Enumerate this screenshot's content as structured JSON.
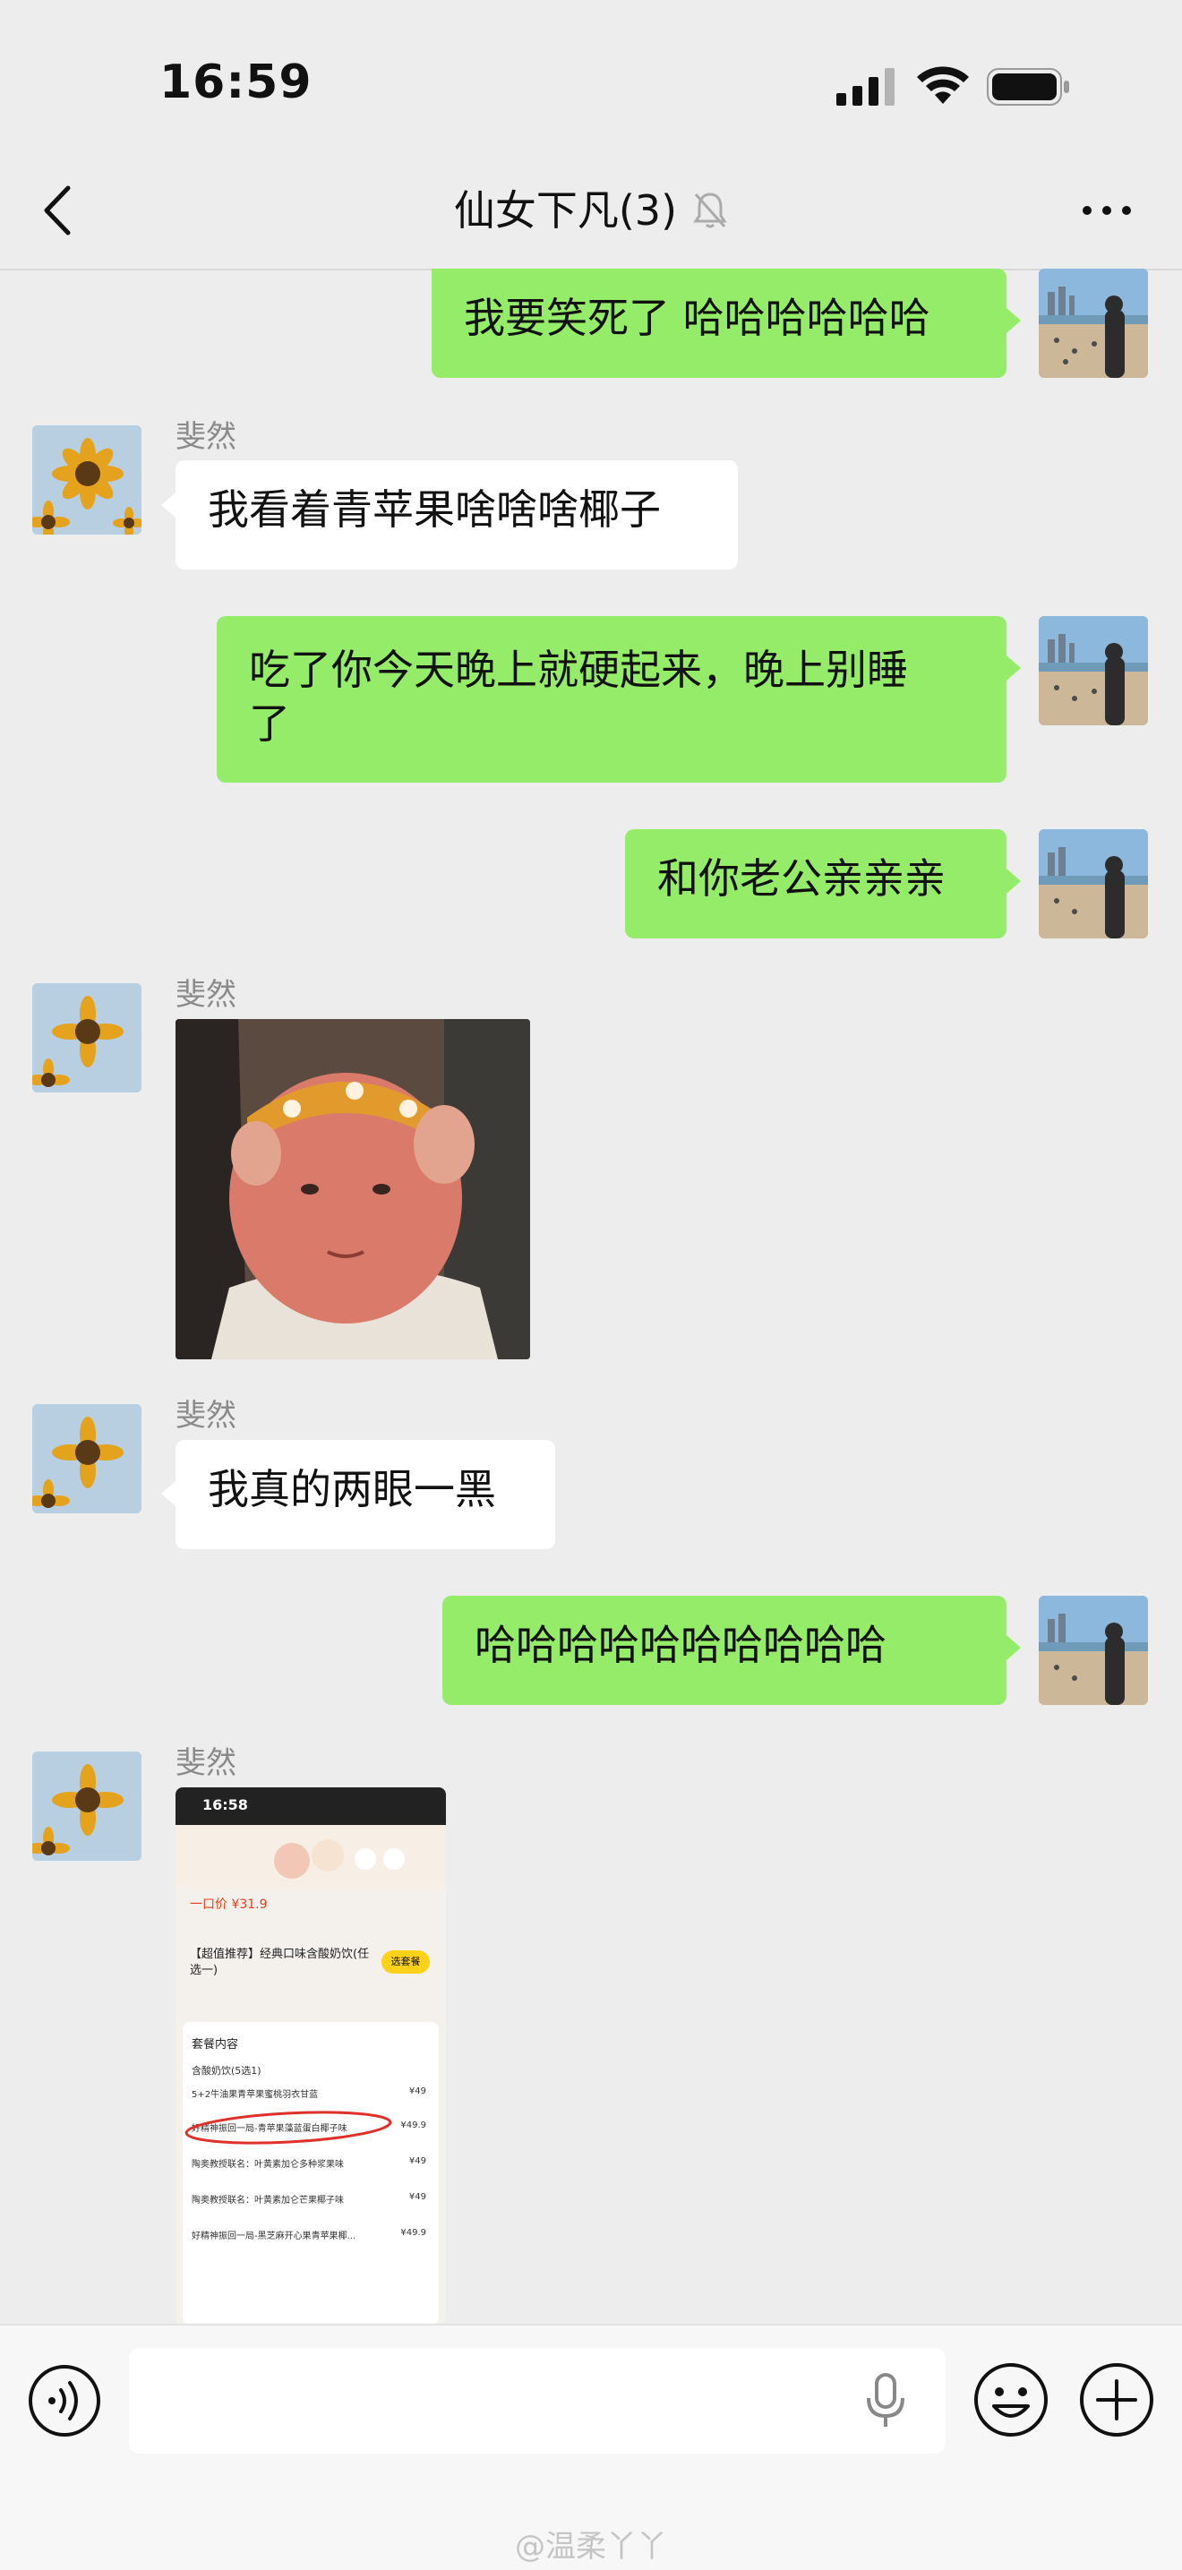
{
  "status_bar": {
    "time": "16:59"
  },
  "header": {
    "title": "仙女下凡(3)"
  },
  "messages": [
    {
      "from": "me",
      "text": "我要笑死了 哈哈哈哈哈哈"
    },
    {
      "from": "other",
      "sender": "斐然",
      "text": "我看着青苹果啥啥啥椰子"
    },
    {
      "from": "me",
      "text_line1": "吃了你今天晚上就硬起来，晚上别睡",
      "text_line2": "了"
    },
    {
      "from": "me",
      "text": "和你老公亲亲亲"
    },
    {
      "from": "other",
      "sender": "斐然",
      "type": "image"
    },
    {
      "from": "other",
      "sender": "斐然",
      "text": "我真的两眼一黑"
    },
    {
      "from": "me",
      "text": "哈哈哈哈哈哈哈哈哈哈"
    },
    {
      "from": "other",
      "sender": "斐然",
      "type": "screenshot"
    }
  ],
  "screenshot": {
    "time": "16:58",
    "price": "一口价 ¥31.9",
    "title": "【超值推荐】经典口味含酸奶饮(任选一)",
    "button": "选套餐",
    "section": "套餐内容",
    "section_sub": "含酸奶饮(5选1)",
    "rows": [
      {
        "name": "5+2牛油果青苹果蜜桃羽衣甘蓝",
        "price": "¥49"
      },
      {
        "name": "好精神振回一局-青苹果藻蓝蛋白椰子味",
        "price": "¥49.9"
      },
      {
        "name": "陶奥教授联名：叶黄素加仑多种浆果味",
        "price": "¥49"
      },
      {
        "name": "陶奥教授联名：叶黄素加仑芒果椰子味",
        "price": "¥49"
      },
      {
        "name": "好精神振回一局-黑芝麻开心果青苹果椰...",
        "price": "¥49.9"
      }
    ]
  },
  "watermark": "@温柔丫丫",
  "colors": {
    "my_bubble": "#95ec69",
    "other_bubble": "#ffffff",
    "background": "#ededed"
  }
}
